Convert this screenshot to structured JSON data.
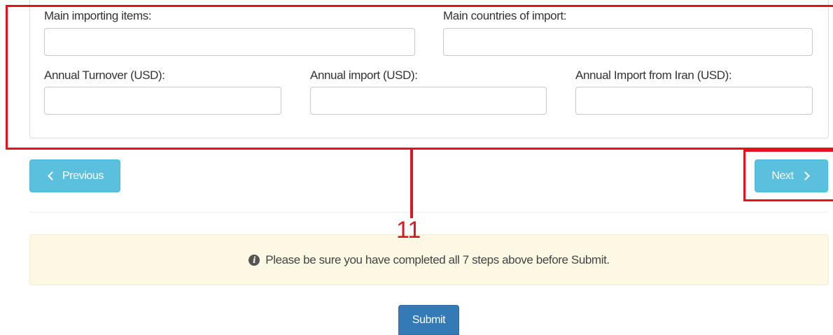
{
  "form": {
    "main_importing_items": {
      "label": "Main importing items:",
      "value": "",
      "placeholder": ""
    },
    "main_countries_of_import": {
      "label": "Main countries of import:",
      "value": "",
      "placeholder": ""
    },
    "annual_turnover": {
      "label": "Annual Turnover (USD):",
      "value": "",
      "placeholder": ""
    },
    "annual_import": {
      "label": "Annual import (USD):",
      "value": "",
      "placeholder": ""
    },
    "annual_import_from_iran": {
      "label": "Annual Import from Iran (USD):",
      "value": "",
      "placeholder": ""
    }
  },
  "navigation": {
    "previous_label": "Previous",
    "next_label": "Next"
  },
  "alert": {
    "message": "Please be sure you have completed all 7 steps above before Submit.",
    "icon": "info-circle-icon"
  },
  "submit": {
    "label": "Submit"
  },
  "annotation": {
    "step_number": "11",
    "color": "#e0141e"
  },
  "colors": {
    "info_button": "#5bc0de",
    "primary_button": "#337ab7",
    "alert_background": "#fcf8e3"
  }
}
